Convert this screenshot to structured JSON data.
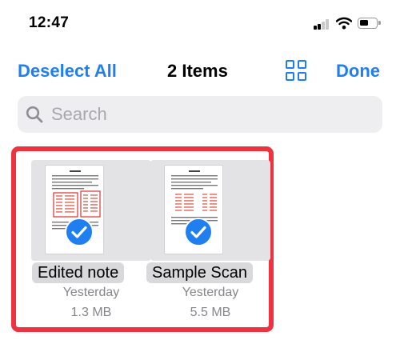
{
  "status_bar": {
    "time": "12:47",
    "signal_icon": "cellular-signal-icon",
    "wifi_icon": "wifi-icon",
    "battery_icon": "battery-icon",
    "battery_level": 0.45
  },
  "nav": {
    "deselect_label": "Deselect All",
    "title": "2 Items",
    "view_icon": "grid-view-icon",
    "done_label": "Done"
  },
  "search": {
    "placeholder": "Search",
    "value": "",
    "icon": "search-icon"
  },
  "files": [
    {
      "name": "Edited note",
      "date": "Yesterday",
      "size": "1.3 MB",
      "selected": true
    },
    {
      "name": "Sample Scan",
      "date": "Yesterday",
      "size": "5.5 MB",
      "selected": true
    }
  ],
  "colors": {
    "accent": "#1f7ff0",
    "selection_border": "#ee3340",
    "secondary_text": "#86868b",
    "tile_background": "#e3e3e6"
  }
}
